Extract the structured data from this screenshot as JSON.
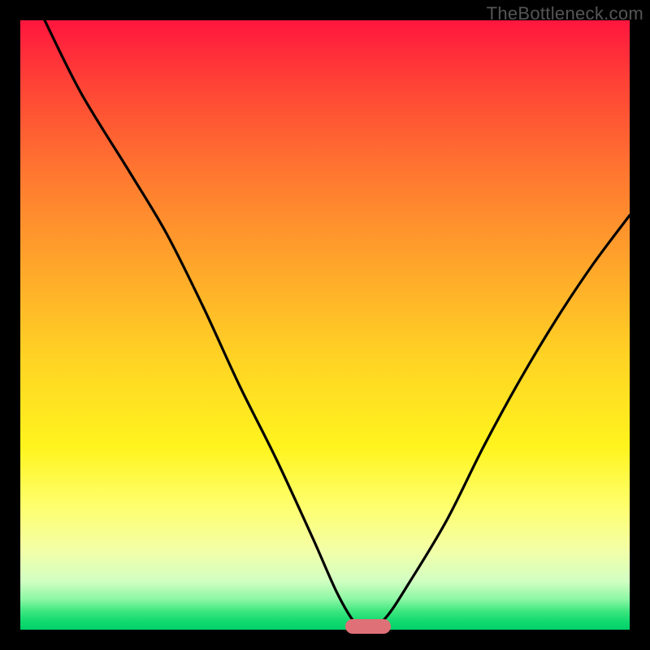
{
  "watermark": "TheBottleneck.com",
  "colors": {
    "frame": "#000000",
    "curve": "#000000",
    "marker": "#e07078",
    "gradient_top": "#ff163e",
    "gradient_bottom": "#00d168"
  },
  "chart_data": {
    "type": "line",
    "title": "",
    "xlabel": "",
    "ylabel": "",
    "xlim": [
      0,
      100
    ],
    "ylim": [
      0,
      100
    ],
    "grid": false,
    "legend": false,
    "description": "V-shaped bottleneck percentage curve on gradient background; minimum marks optimal match point",
    "series": [
      {
        "name": "bottleneck-curve",
        "x": [
          4,
          10,
          18,
          24,
          30,
          36,
          42,
          48,
          52,
          55,
          57,
          60,
          64,
          70,
          76,
          82,
          88,
          94,
          100
        ],
        "values": [
          100,
          88,
          75,
          65,
          53,
          40,
          28,
          15,
          6,
          1,
          0,
          2,
          8,
          18,
          30,
          41,
          51,
          60,
          68
        ]
      }
    ],
    "annotations": [
      {
        "type": "marker",
        "x": 57,
        "y": 0.5,
        "shape": "pill"
      }
    ]
  }
}
